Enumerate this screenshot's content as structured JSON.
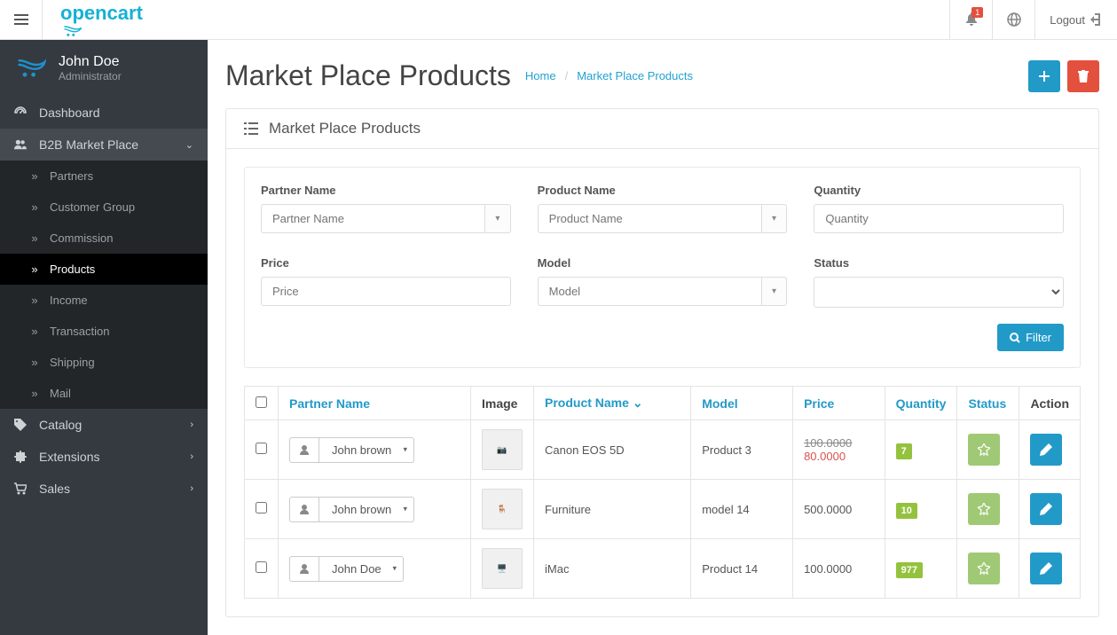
{
  "header": {
    "notification_count": "1",
    "logout_label": "Logout"
  },
  "profile": {
    "name": "John Doe",
    "role": "Administrator"
  },
  "sidebar": {
    "items": [
      {
        "label": "Dashboard",
        "icon": "dashboard-icon",
        "sub": null
      },
      {
        "label": "B2B Market Place",
        "icon": "users-icon",
        "open": true,
        "sub": [
          {
            "label": "Partners"
          },
          {
            "label": "Customer Group"
          },
          {
            "label": "Commission"
          },
          {
            "label": "Products",
            "active": true
          },
          {
            "label": "Income"
          },
          {
            "label": "Transaction"
          },
          {
            "label": "Shipping"
          },
          {
            "label": "Mail"
          }
        ]
      },
      {
        "label": "Catalog",
        "icon": "tag-icon",
        "sub": []
      },
      {
        "label": "Extensions",
        "icon": "puzzle-icon",
        "sub": []
      },
      {
        "label": "Sales",
        "icon": "cart-icon",
        "sub": []
      }
    ]
  },
  "page": {
    "title": "Market Place Products",
    "breadcrumb_home": "Home",
    "breadcrumb_current": "Market Place Products"
  },
  "panel": {
    "title": "Market Place Products"
  },
  "filters": {
    "partner_name": {
      "label": "Partner Name",
      "placeholder": "Partner Name"
    },
    "product_name": {
      "label": "Product Name",
      "placeholder": "Product Name"
    },
    "quantity": {
      "label": "Quantity",
      "placeholder": "Quantity"
    },
    "price": {
      "label": "Price",
      "placeholder": "Price"
    },
    "model": {
      "label": "Model",
      "placeholder": "Model"
    },
    "status": {
      "label": "Status"
    },
    "filter_button": "Filter"
  },
  "table": {
    "headers": {
      "partner_name": "Partner Name",
      "image": "Image",
      "product_name": "Product Name",
      "model": "Model",
      "price": "Price",
      "quantity": "Quantity",
      "status": "Status",
      "action": "Action"
    },
    "rows": [
      {
        "partner": "John brown",
        "product": "Canon EOS 5D",
        "model": "Product 3",
        "price_old": "100.0000",
        "price": "80.0000",
        "qty": "7"
      },
      {
        "partner": "John brown",
        "product": "Furniture",
        "model": "model 14",
        "price_old": null,
        "price": "500.0000",
        "qty": "10"
      },
      {
        "partner": "John Doe",
        "product": "iMac",
        "model": "Product 14",
        "price_old": null,
        "price": "100.0000",
        "qty": "977"
      }
    ]
  }
}
